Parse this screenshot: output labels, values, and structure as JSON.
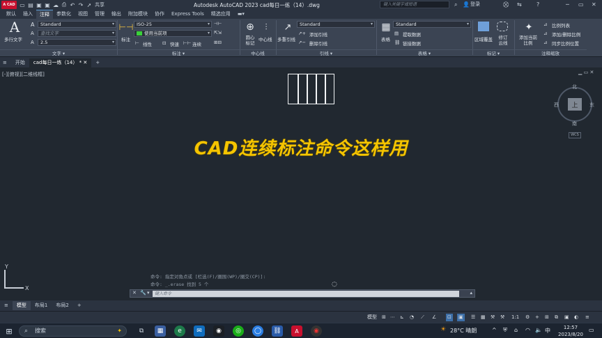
{
  "titlebar": {
    "logo": "A CAD",
    "share": "共享",
    "title": "Autodesk AutoCAD 2023   cad每日一练（14）.dwg",
    "search_placeholder": "键入关键字或短语",
    "user": "登录"
  },
  "menu": {
    "tabs": [
      "默认",
      "插入",
      "注释",
      "参数化",
      "视图",
      "管理",
      "输出",
      "附加模块",
      "协作",
      "Express Tools",
      "精选应用"
    ],
    "active": "注释"
  },
  "ribbon": {
    "text_panel": {
      "label": "文字",
      "big_button": "多行文字",
      "style": "Standard",
      "find_placeholder": "查找文字",
      "height": "2.5"
    },
    "dim_panel": {
      "label": "标注",
      "big_button": "标注",
      "style": "ISO-25",
      "layer": "使用当前项",
      "linear": "线性",
      "quick": "快速",
      "continue": "连续"
    },
    "centerline_panel": {
      "label": "中心线",
      "center_mark": "圆心标记",
      "centerline": "中心线"
    },
    "leader_panel": {
      "label": "引线",
      "big_button": "多重引线",
      "style": "Standard",
      "add": "添加引线",
      "remove": "删除引线"
    },
    "table_panel": {
      "label": "表格",
      "big_button": "表格",
      "style": "Standard",
      "extract": "提取数据",
      "link": "链接数据"
    },
    "markup_panel": {
      "label": "标记",
      "wipeout": "区域覆盖",
      "revcloud": "修订云线"
    },
    "scale_panel": {
      "label": "注释缩放",
      "add_scale": "添加当前比例",
      "scale_list": "比例列表",
      "add_delete": "添加/删除比例",
      "sync": "同步比例位置"
    }
  },
  "doctabs": {
    "start": "开始",
    "file": "cad每日一练（14）"
  },
  "canvas": {
    "view_label": "[-][俯视][二维线框]",
    "caption": "CAD连续标注命令这样用",
    "compass": {
      "north": "北",
      "south": "南",
      "east": "东",
      "west": "西",
      "top": "上",
      "wcs": "WCS"
    }
  },
  "command": {
    "history": [
      "命令: 指定对角点或 [栏选(F)/圈围(WP)/圈交(CP)]:",
      "命令: _.erase 找到 5 个"
    ],
    "placeholder": "键入命令"
  },
  "layouts": {
    "tabs": [
      "模型",
      "布局1",
      "布局2"
    ],
    "active": "模型"
  },
  "statusbar": {
    "model": "模型",
    "scale": "1:1"
  },
  "taskbar": {
    "search": "搜索",
    "weather": "28°C 晴朗",
    "ime": "中",
    "time": "12:57",
    "date": "2023/8/20"
  }
}
